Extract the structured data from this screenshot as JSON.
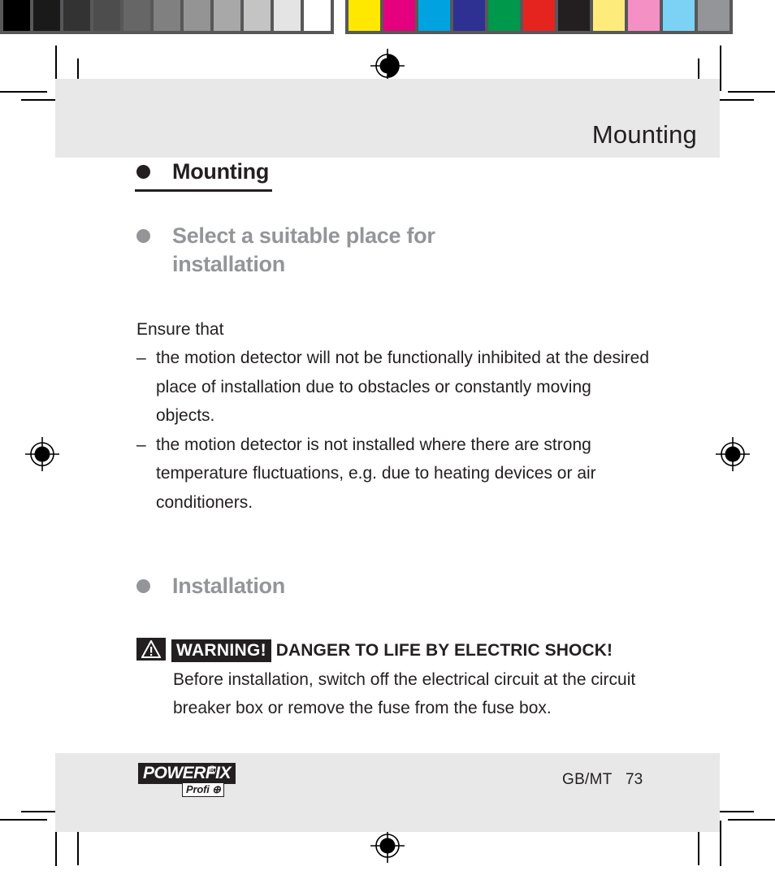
{
  "calibration": {
    "gray_ramp": [
      "#000000",
      "#1a1a1a",
      "#333333",
      "#4d4d4d",
      "#666666",
      "#808080",
      "#949494",
      "#a8a8a8",
      "#c4c4c4",
      "#e4e4e4",
      "#ffffff"
    ],
    "color_patches": [
      "#ffe800",
      "#e5007d",
      "#00a3e0",
      "#2e3192",
      "#00984a",
      "#e52420",
      "#231f20",
      "#fdec7c",
      "#f490c4",
      "#7cd2f5",
      "#939598"
    ],
    "bar_background": "#58585a"
  },
  "header": {
    "title": "Mounting",
    "band_color": "#e8e8e8"
  },
  "content": {
    "heading_1": "Mounting",
    "heading_2": "Select a suitable place for\ninstallation",
    "heading_3": "Installation",
    "intro": "Ensure that",
    "bullets": [
      {
        "dash": "–",
        "text": "the motion detector will not be functionally inhibited at the desired place of installation due to obstacles or constantly moving objects."
      },
      {
        "dash": "–",
        "text": "the motion detector is not installed where there are strong temperature fluctuations, e.g. due to heating devices or air conditioners."
      }
    ],
    "warning": {
      "tag": "WARNING!",
      "title": "DANGER TO LIFE BY ELECTRIC SHOCK!",
      "text": "Before installation, switch off the electrical circuit at the circuit breaker box or remove the fuse from the fuse box."
    }
  },
  "footer": {
    "logo_main": "POWERFIX",
    "logo_registered": "®",
    "logo_sub": "Profi ⊕",
    "page_label": "GB/MT",
    "page_number": "73",
    "band_color": "#e8e8e8"
  },
  "colors": {
    "heading_dark": "#231f20",
    "heading_gray": "#939598",
    "body_text": "#231f20"
  }
}
